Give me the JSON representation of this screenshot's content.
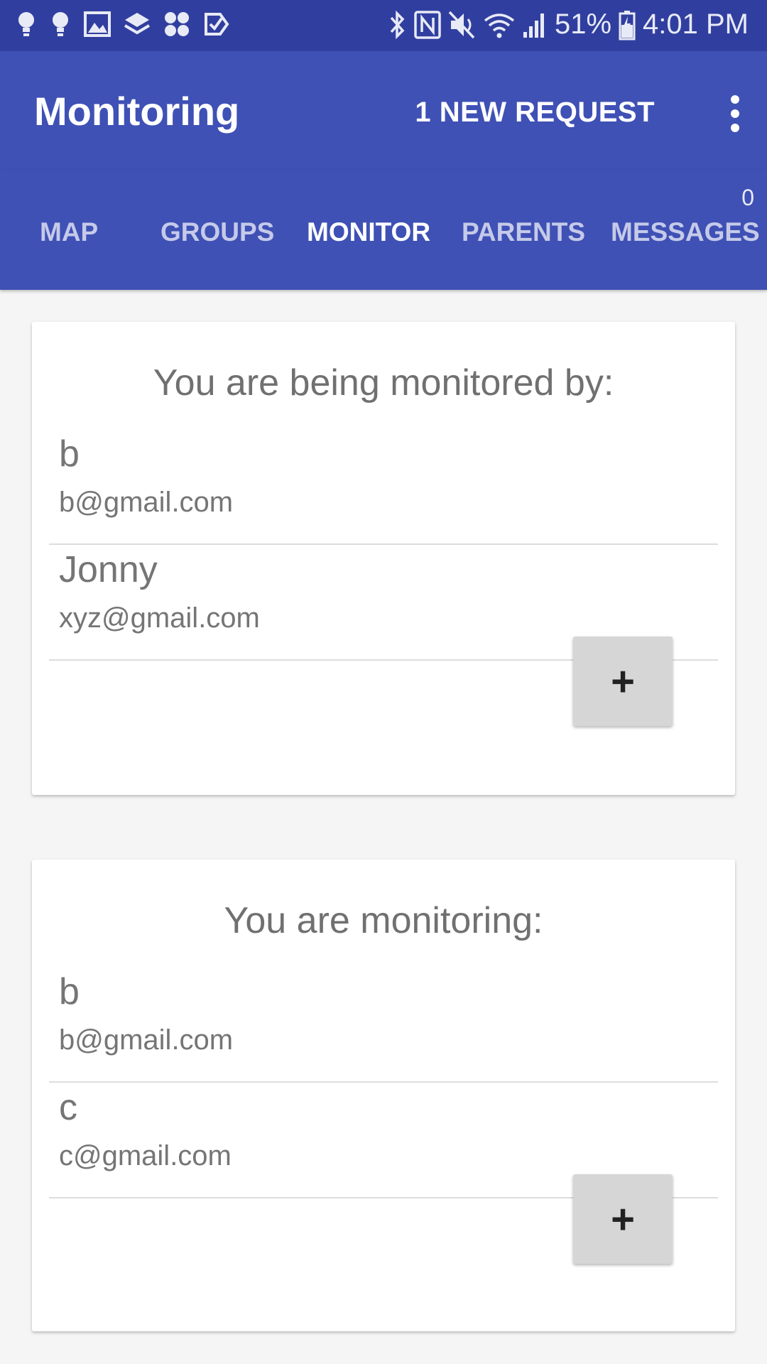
{
  "status_bar": {
    "battery": "51%",
    "time": "4:01 PM",
    "left_icons": [
      "bulb-icon",
      "bulb-icon",
      "image-icon",
      "layers-icon",
      "apps-icon",
      "check-icon"
    ],
    "right_icons": [
      "bluetooth-icon",
      "nfc-icon",
      "mute-icon",
      "wifi-icon",
      "signal-icon",
      "battery-icon"
    ]
  },
  "app_bar": {
    "title": "Monitoring",
    "action_label": "1 NEW REQUEST",
    "color": "#3f51b5"
  },
  "tabs": [
    {
      "label": "MAP",
      "active": false
    },
    {
      "label": "GROUPS",
      "active": false
    },
    {
      "label": "MONITOR",
      "active": true
    },
    {
      "label": "PARENTS",
      "active": false
    },
    {
      "label": "MESSAGES",
      "active": false,
      "badge": "0"
    }
  ],
  "monitored_by": {
    "title": "You are being monitored by:",
    "entries": [
      {
        "name": "b",
        "email": "b@gmail.com"
      },
      {
        "name": "Jonny",
        "email": "xyz@gmail.com"
      }
    ],
    "add_label": "+"
  },
  "monitoring": {
    "title": "You are monitoring:",
    "entries": [
      {
        "name": "b",
        "email": "b@gmail.com"
      },
      {
        "name": "c",
        "email": "c@gmail.com"
      }
    ],
    "add_label": "+"
  }
}
